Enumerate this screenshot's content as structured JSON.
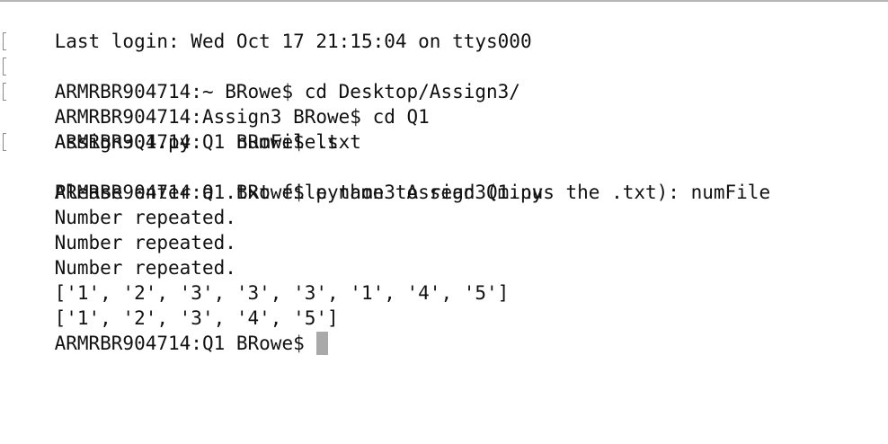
{
  "terminal": {
    "lines": [
      {
        "text": "Last login: Wed Oct 17 21:15:04 on ttys000",
        "marked": false
      },
      {
        "text": "ARMRBR904714:~ BRowe$ cd Desktop/Assign3/",
        "marked": true
      },
      {
        "text": "ARMRBR904714:Assign3 BRowe$ cd Q1",
        "marked": true
      },
      {
        "text": "ARMRBR904714:Q1 BRowe$ ls",
        "marked": true
      },
      {
        "text": "Assign3Q1.py    numFile.txt",
        "marked": false
      },
      {
        "text": "ARMRBR904714:Q1 BRowe$ python3 Assign3Q1.py",
        "marked": true
      },
      {
        "text": "Please enter a .txt file name to read (minus the .txt): numFile",
        "marked": false
      },
      {
        "text": "Number repeated.",
        "marked": false
      },
      {
        "text": "Number repeated.",
        "marked": false
      },
      {
        "text": "Number repeated.",
        "marked": false
      },
      {
        "text": "['1', '2', '3', '3', '3', '1', '4', '5']",
        "marked": false
      },
      {
        "text": "['1', '2', '3', '4', '5']",
        "marked": false
      }
    ],
    "prompt": "ARMRBR904714:Q1 BRowe$ "
  }
}
